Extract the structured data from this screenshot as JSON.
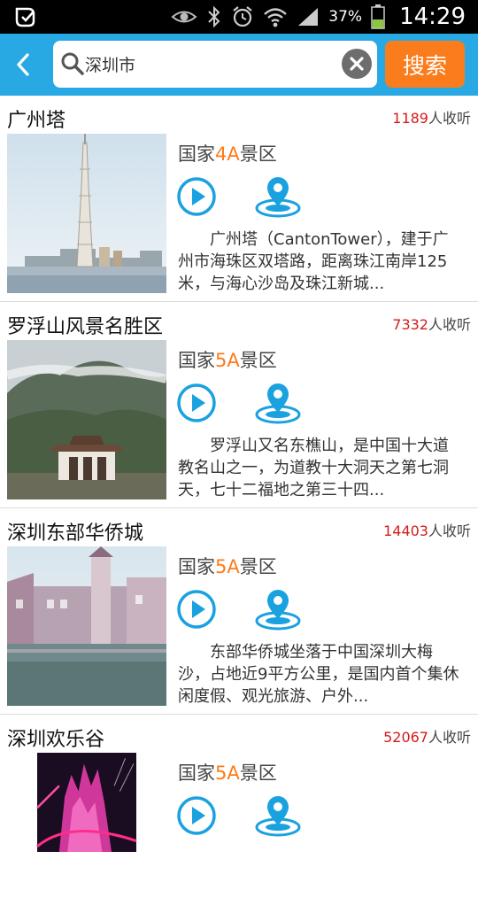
{
  "statusbar": {
    "battery_pct": "37%",
    "time": "14:29"
  },
  "header": {
    "search_value": "深圳市",
    "search_button": "搜索"
  },
  "results": [
    {
      "name": "广州塔",
      "listen_count": "1189",
      "listen_suffix": "人收听",
      "grade_prefix": "国家",
      "grade_level": "4A",
      "grade_suffix": "景区",
      "description": "广州塔（CantonTower），建于广州市海珠区双塔路，距离珠江南岸125米，与海心沙岛及珠江新城..."
    },
    {
      "name": "罗浮山风景名胜区",
      "listen_count": "7332",
      "listen_suffix": "人收听",
      "grade_prefix": "国家",
      "grade_level": "5A",
      "grade_suffix": "景区",
      "description": "罗浮山又名东樵山，是中国十大道教名山之一，为道教十大洞天之第七洞天，七十二福地之第三十四..."
    },
    {
      "name": "深圳东部华侨城",
      "listen_count": "14403",
      "listen_suffix": "人收听",
      "grade_prefix": "国家",
      "grade_level": "5A",
      "grade_suffix": "景区",
      "description": "东部华侨城坐落于中国深圳大梅沙，占地近9平方公里，是国内首个集休闲度假、观光旅游、户外..."
    },
    {
      "name": "深圳欢乐谷",
      "listen_count": "52067",
      "listen_suffix": "人收听",
      "grade_prefix": "国家",
      "grade_level": "5A",
      "grade_suffix": "景区",
      "description": ""
    }
  ],
  "colors": {
    "header_bg": "#29a9e4",
    "accent_orange": "#fb7c1c",
    "count_red": "#d41b1b",
    "icon_blue": "#1aa1e0"
  },
  "icons": {
    "back": "chevron-left-icon",
    "search": "magnifier-icon",
    "clear": "close-circle-icon",
    "play": "play-circle-icon",
    "location": "map-pin-icon"
  }
}
